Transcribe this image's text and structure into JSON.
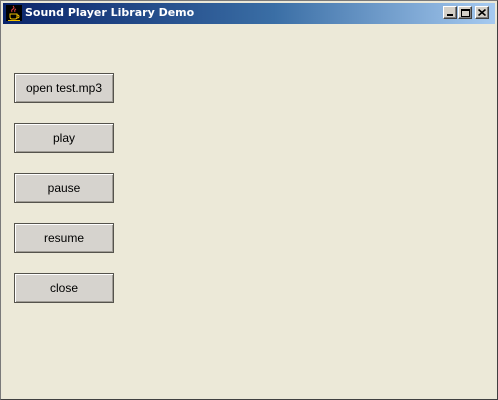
{
  "window": {
    "title": "Sound Player Library Demo",
    "icon": "java-coffee-cup-icon",
    "controls": [
      "minimize-icon",
      "maximize-icon",
      "close-icon"
    ]
  },
  "buttons": [
    {
      "label": "open test.mp3"
    },
    {
      "label": "play"
    },
    {
      "label": "pause"
    },
    {
      "label": "resume"
    },
    {
      "label": "close"
    }
  ],
  "colors": {
    "title_gradient_start": "#0a246a",
    "title_gradient_end": "#a6caf0",
    "client_background": "#ece9d8",
    "button_face": "#d6d3ce"
  }
}
